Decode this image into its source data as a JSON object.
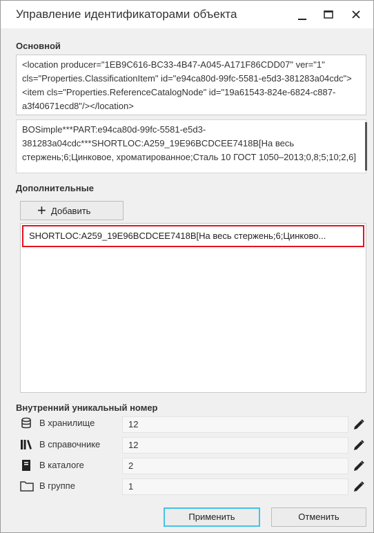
{
  "window": {
    "title": "Управление идентификаторами объекта",
    "minimize": "—",
    "maximize": "☐",
    "close": "✕"
  },
  "main": {
    "heading": "Основной",
    "xml": "<location producer=\"1EB9C616-BC33-4B47-A045-A171F86CDD07\" ver=\"1\" cls=\"Properties.ClassificationItem\" id=\"e94ca80d-99fc-5581-e5d3-381283a04cdc\"><item cls=\"Properties.ReferenceCatalogNode\" id=\"19a61543-824e-6824-c887-a3f40671ecd8\"/></location>",
    "string": "BOSimple***PART:e94ca80d-99fc-5581-e5d3-381283a04cdc***SHORTLOC:A259_19E96BCDCEE7418B[На весь стержень;6;Цинковое, хроматированное;Сталь 10 ГОСТ 1050–2013;0,8;5;10;2,6]"
  },
  "additional": {
    "heading": "Дополнительные",
    "add_label": "Добавить",
    "items": [
      "SHORTLOC:A259_19E96BCDCEE7418B[На весь стержень;6;Цинково..."
    ]
  },
  "internal": {
    "heading": "Внутренний уникальный номер",
    "rows": [
      {
        "label": "В хранилище",
        "value": "12",
        "icon": "database-icon"
      },
      {
        "label": "В справочнике",
        "value": "12",
        "icon": "library-books-icon"
      },
      {
        "label": "В каталоге",
        "value": "2",
        "icon": "catalog-book-icon"
      },
      {
        "label": "В группе",
        "value": "1",
        "icon": "folder-icon"
      }
    ]
  },
  "buttons": {
    "apply": "Применить",
    "cancel": "Отменить"
  },
  "colors": {
    "selection_border": "#e8101e",
    "apply_focus": "#43c3e6"
  }
}
